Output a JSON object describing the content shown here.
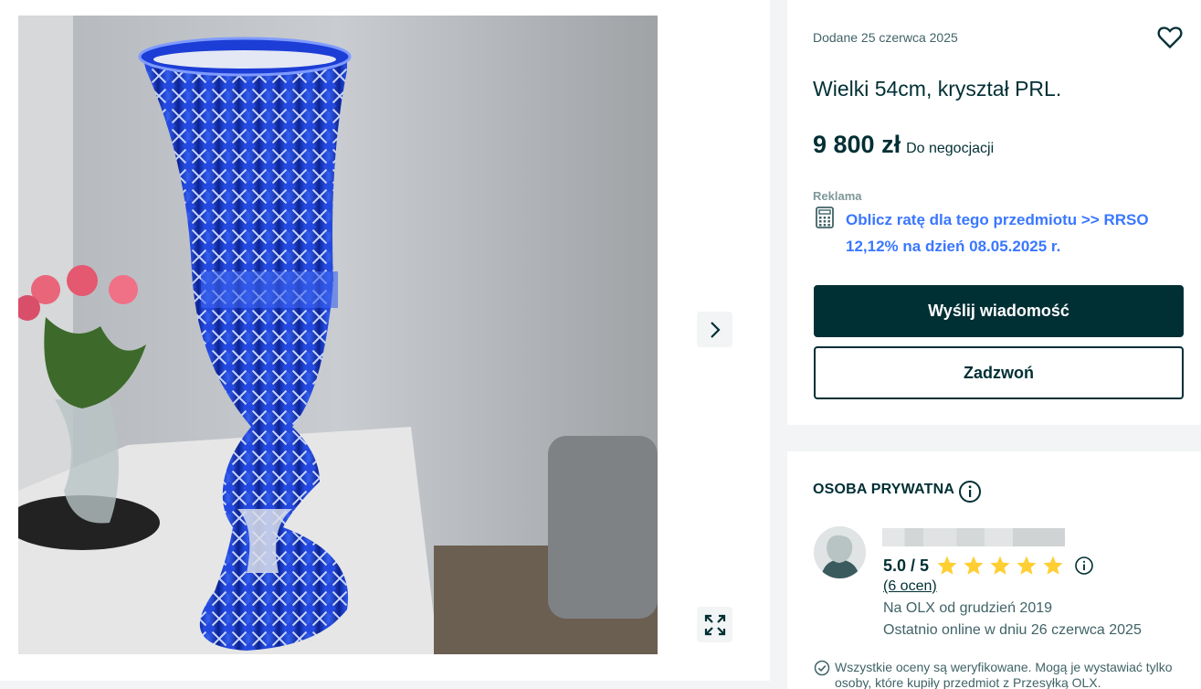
{
  "gallery": {
    "photo_alt": "",
    "next_icon": "chevron-right-icon",
    "fullscreen_icon": "expand-icon"
  },
  "listing": {
    "date": "Dodane 25 czerwca 2025",
    "favorite_icon": "heart-icon",
    "title": "Wielki 54cm, kryształ PRL.",
    "price": "9 800 zł",
    "negotiable": "Do negocjacji",
    "ad_label": "Reklama",
    "installment_link": "Oblicz ratę dla tego przedmiotu >> RRSO 12,12% na dzień 08.05.2025 r.",
    "send_message": "Wyślij wiadomość",
    "call": "Zadzwoń"
  },
  "seller": {
    "type": "OSOBA PRYWATNA",
    "rating": "5.0 / 5",
    "stars": 5,
    "ratings_count": "(6 ocen)",
    "since": "Na OLX od grudzień 2019",
    "last_online": "Ostatnio online w dniu 26 czerwca 2025",
    "verified_note": "Wszystkie oceny są weryfikowane. Mogą je wystawiać tylko osoby, które kupiły przedmiot z Przesyłką OLX."
  },
  "colors": {
    "primary": "#002f34",
    "link": "#3a77ff",
    "star": "#ffce32",
    "vase": "#1a3fd0"
  }
}
